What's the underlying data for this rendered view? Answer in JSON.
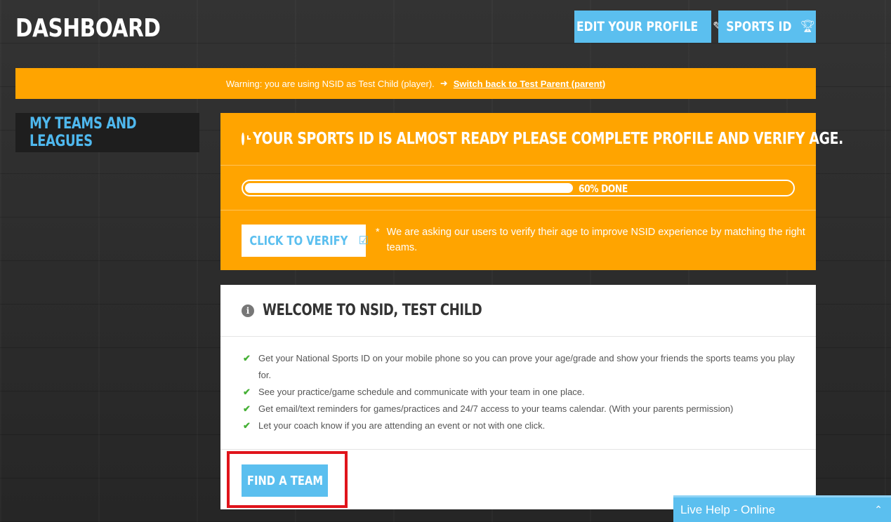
{
  "header": {
    "title": "DASHBOARD",
    "edit_profile_label": "EDIT YOUR PROFILE",
    "sports_id_label": "SPORTS ID"
  },
  "warning": {
    "text": "Warning: you are using NSID as Test Child (player).",
    "link_label": "Switch back to Test Parent (parent)"
  },
  "sidebar": {
    "items": [
      {
        "label": "MY TEAMS AND LEAGUES"
      }
    ]
  },
  "verify": {
    "heading": "YOUR SPORTS ID IS ALMOST READY PLEASE COMPLETE PROFILE AND VERIFY AGE.",
    "progress_value": 0.6,
    "progress_label": "60% DONE",
    "button_label": "CLICK TO VERIFY",
    "note": "We are asking our users to verify their age to improve NSID experience by matching the right teams."
  },
  "welcome": {
    "heading": "WELCOME TO NSID, TEST CHILD",
    "benefits": [
      "Get your National Sports ID on your mobile phone so you can prove your age/grade and show your friends the sports teams you play for.",
      "See your practice/game schedule and communicate with your team in one place.",
      "Get email/text reminders for games/practices and 24/7 access to your teams calendar. (With your parents permission)",
      "Let your coach know if you are attending an event or not with one click."
    ],
    "find_team_label": "FIND A TEAM"
  },
  "live_help": {
    "label": "Live Help - Online"
  },
  "colors": {
    "accent_blue": "#5bbfef",
    "warning_orange": "#ffa400",
    "highlight_red": "#e0141b",
    "check_green": "#45b035"
  },
  "icons": {
    "edit_profile": "edit-icon",
    "sports_id": "trophy-icon",
    "switch_link": "sign-in-icon",
    "verify_heading": "clock-icon",
    "verify_button": "check-square-icon",
    "welcome_heading": "info-icon",
    "benefit": "check-icon",
    "live_help": "chevron-up-icon"
  }
}
